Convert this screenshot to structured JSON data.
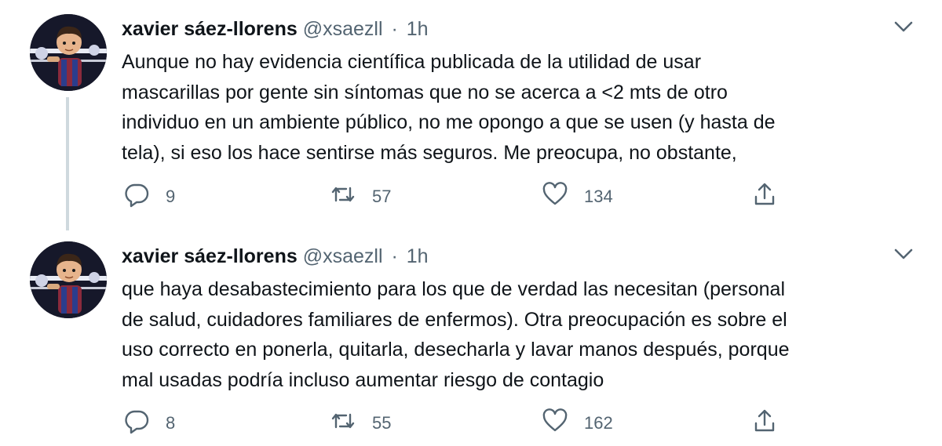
{
  "tweets": [
    {
      "author_name": "xavier sáez-llorens",
      "handle": "@xsaezll",
      "separator": "·",
      "time": "1h",
      "text_lines": [
        "Aunque no hay evidencia científica publicada de la utilidad de usar",
        "mascarillas por gente sin síntomas que no se acerca a <2 mts de otro",
        "individuo en un ambiente público, no me opongo a que se usen (y hasta de",
        "tela), si eso los hace sentirse más seguros. Me preocupa, no obstante,"
      ],
      "replies": "9",
      "retweets": "57",
      "likes": "134"
    },
    {
      "author_name": "xavier sáez-llorens",
      "handle": "@xsaezll",
      "separator": "·",
      "time": "1h",
      "text_lines": [
        "que haya desabastecimiento para los que de verdad las necesitan (personal",
        "de salud, cuidadores familiares de enfermos). Otra preocupación es sobre el",
        "uso correcto en ponerla, quitarla, desecharla y lavar manos después, porque",
        "mal usadas podría incluso aumentar riesgo de contagio"
      ],
      "replies": "8",
      "retweets": "55",
      "likes": "162"
    }
  ],
  "icons": {
    "reply": "reply-icon",
    "retweet": "retweet-icon",
    "like": "heart-icon",
    "share": "share-icon",
    "caret": "chevron-down-icon"
  },
  "colors": {
    "text": "#0f1419",
    "secondary": "#536471",
    "thread_line": "#cfd9de"
  }
}
